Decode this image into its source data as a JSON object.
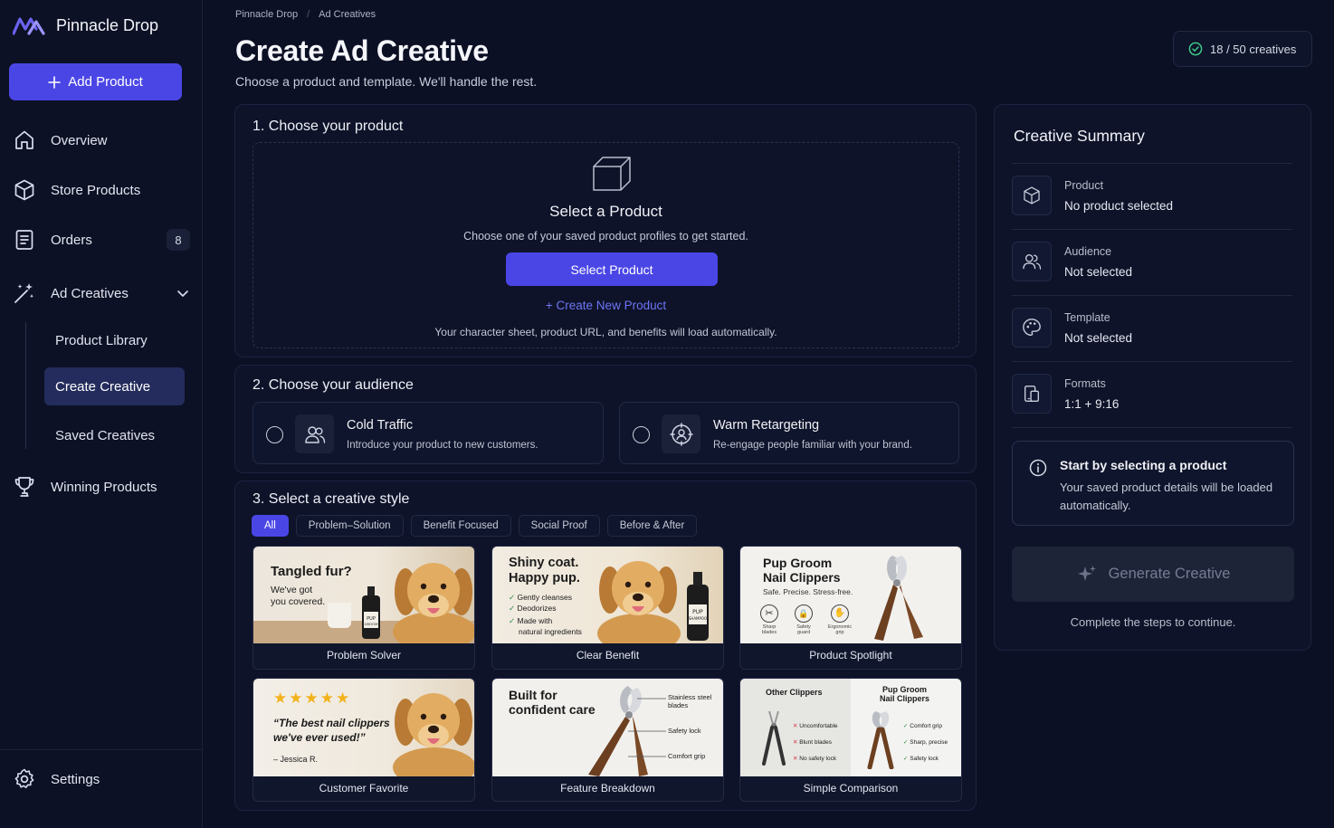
{
  "app": {
    "name": "Pinnacle Drop"
  },
  "sidebar": {
    "add_button": "Add Product",
    "items": [
      {
        "label": "Overview",
        "icon": "home-icon"
      },
      {
        "label": "Store Products",
        "icon": "cube-icon"
      },
      {
        "label": "Orders",
        "icon": "receipt-icon",
        "badge": "8"
      },
      {
        "label": "Ad Creatives",
        "icon": "magic-wand-icon",
        "expanded": true
      },
      {
        "label": "Winning Products",
        "icon": "trophy-icon"
      }
    ],
    "sub_items": [
      {
        "label": "Product Library"
      },
      {
        "label": "Create Creative",
        "active": true
      },
      {
        "label": "Saved Creatives"
      }
    ],
    "settings": "Settings"
  },
  "breadcrumb": [
    "Pinnacle Drop",
    "Ad Creatives"
  ],
  "header": {
    "title": "Create Ad Creative",
    "subtitle": "Choose a product and template. We'll handle the rest.",
    "quota": "18 / 50 creatives"
  },
  "step1": {
    "title": "1. Choose your product",
    "empty_title": "Select a Product",
    "empty_desc": "Choose one of your saved product profiles to get started.",
    "select_button": "Select Product",
    "create_link": "+ Create New Product",
    "note": "Your character sheet, product URL, and benefits will load automatically."
  },
  "step2": {
    "title": "2. Choose your audience",
    "options": [
      {
        "title": "Cold Traffic",
        "desc": "Introduce your product to new customers.",
        "icon": "users-icon"
      },
      {
        "title": "Warm Retargeting",
        "desc": "Re-engage people familiar with your brand.",
        "icon": "target-user-icon"
      }
    ]
  },
  "step3": {
    "title": "3. Select a creative style",
    "filters": [
      "All",
      "Problem–Solution",
      "Benefit Focused",
      "Social Proof",
      "Before & After"
    ],
    "active_filter": "All",
    "templates": [
      {
        "name": "Problem Solver",
        "headline": "Tangled fur?",
        "sub": [
          "We've got",
          "you covered."
        ],
        "bottle_label": [
          "PUP",
          "GROOM"
        ]
      },
      {
        "name": "Clear Benefit",
        "headline": [
          "Shiny coat.",
          "Happy pup."
        ],
        "checks": [
          "Gently cleanses",
          "Deodorizes",
          "Made with",
          "natural ingredients"
        ],
        "bottle_label": [
          "PUP",
          "SHAMPOO"
        ]
      },
      {
        "name": "Product Spotlight",
        "headline": [
          "Pup Groom",
          "Nail Clippers"
        ],
        "tagline": "Safe. Precise. Stress-free.",
        "features": [
          [
            "Sharp",
            "blades"
          ],
          [
            "Safety",
            "guard"
          ],
          [
            "Ergonomic",
            "grip"
          ]
        ]
      },
      {
        "name": "Customer Favorite",
        "stars": 5,
        "quote": [
          "“The best nail clippers",
          "we've ever used!”"
        ],
        "author": "– Jessica R."
      },
      {
        "name": "Feature Breakdown",
        "headline": [
          "Built for",
          "confident care"
        ],
        "callouts": [
          [
            "Stainless steel",
            "blades"
          ],
          [
            "Safety lock"
          ],
          [
            "Comfort grip"
          ]
        ]
      },
      {
        "name": "Simple Comparison",
        "left_title": "Other Clippers",
        "right_title": [
          "Pup Groom",
          "Nail Clippers"
        ],
        "left_items": [
          "Uncomfortable",
          "Blunt blades",
          "No safety lock"
        ],
        "right_items": [
          "Comfort grip",
          "Sharp, precise",
          "Safety lock"
        ]
      }
    ]
  },
  "summary": {
    "title": "Creative Summary",
    "rows": [
      {
        "label": "Product",
        "value": "No product selected",
        "icon": "cube-icon"
      },
      {
        "label": "Audience",
        "value": "Not selected",
        "icon": "users-icon"
      },
      {
        "label": "Template",
        "value": "Not selected",
        "icon": "palette-icon"
      },
      {
        "label": "Formats",
        "value": "1:1 + 9:16",
        "icon": "devices-icon"
      }
    ],
    "info_title": "Start by selecting a product",
    "info_desc": "Your saved product details will be loaded automatically.",
    "generate_button": "Generate Creative",
    "generate_note": "Complete the steps to continue."
  },
  "colors": {
    "accent": "#4a46e6",
    "link": "#6e74f5",
    "background": "#0b1024",
    "card": "#0e1329",
    "success": "#3ec78a"
  }
}
